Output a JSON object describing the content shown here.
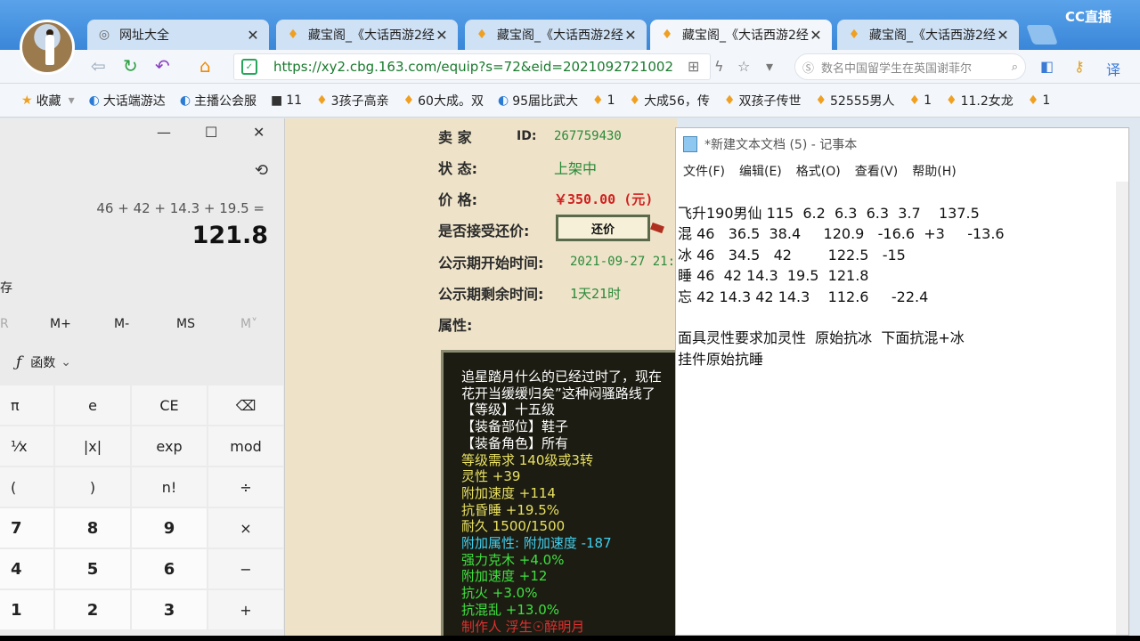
{
  "browser": {
    "tabs": [
      {
        "label": "网址大全",
        "icon": "globe-icon"
      },
      {
        "label": "藏宝阁_《大话西游2经",
        "icon": "shop-icon"
      },
      {
        "label": "藏宝阁_《大话西游2经",
        "icon": "shop-icon"
      },
      {
        "label": "藏宝阁_《大话西游2经",
        "icon": "shop-icon"
      },
      {
        "label": "藏宝阁_《大话西游2经",
        "icon": "shop-icon"
      }
    ],
    "overlay_logo": "CC直播",
    "url": "https://xy2.cbg.163.com/equip?s=72&eid=2021092721002",
    "search_text": "数名中国留学生在英国谢菲尔",
    "bookmarks": [
      "收藏",
      "大话端游达",
      "主播公会服",
      "11",
      "3孩子高亲",
      "60大成。双",
      "95届比武大",
      "1",
      "大成56，传",
      "双孩子传世",
      "52555男人",
      "1",
      "11.2女龙",
      "1"
    ]
  },
  "listing": {
    "seller_label": "卖 家",
    "seller_id_label": "ID:",
    "seller_id": "267759430",
    "status_label": "状 态:",
    "status": "上架中",
    "price_label": "价 格:",
    "price": "￥350.00 (元)",
    "bargain_label": "是否接受还价:",
    "bargain_button": "还价",
    "start_label": "公示期开始时间:",
    "start_time": "2021-09-27 21:",
    "remain_label": "公示期剩余时间:",
    "remain": "1天21时",
    "attr_label": "属性:",
    "desc_lines": [
      {
        "text": "追星踏月什么的已经过时了，现在",
        "color": "#ffffff"
      },
      {
        "text": "花开当缓缓归矣”这种闷骚路线了",
        "color": "#ffffff"
      },
      {
        "text": "【等级】十五级",
        "color": "#ffffff"
      },
      {
        "text": "【装备部位】鞋子",
        "color": "#ffffff"
      },
      {
        "text": "【装备角色】所有",
        "color": "#ffffff"
      },
      {
        "text": "等级需求 140级或3转",
        "color": "#e8e060"
      },
      {
        "text": "灵性 +39",
        "color": "#e8e060"
      },
      {
        "text": "附加速度 +114",
        "color": "#e8e060"
      },
      {
        "text": "抗昏睡 +19.5%",
        "color": "#e8e060"
      },
      {
        "text": "耐久 1500/1500",
        "color": "#e8e060"
      },
      {
        "text": "附加属性: 附加速度 -187",
        "color": "#40d0f0"
      },
      {
        "text": "强力克木 +4.0%",
        "color": "#40e040"
      },
      {
        "text": "附加速度 +12",
        "color": "#40e040"
      },
      {
        "text": "抗火 +3.0%",
        "color": "#40e040"
      },
      {
        "text": "抗混乱 +13.0%",
        "color": "#40e040"
      },
      {
        "text": "制作人 浮生☉醉明月",
        "color": "#e03030"
      }
    ]
  },
  "calculator": {
    "expression": "46 + 42 + 14.3 + 19.5 =",
    "result": "121.8",
    "side_text": "存",
    "memory": [
      "R",
      "M+",
      "M-",
      "MS",
      "M˅"
    ],
    "function_label": "函数",
    "keys": [
      "π",
      "e",
      "CE",
      "⌫",
      "¹⁄x",
      "|x|",
      "exp",
      "mod",
      "(",
      ")",
      "n!",
      "÷",
      "7",
      "8",
      "9",
      "×",
      "4",
      "5",
      "6",
      "−",
      "1",
      "2",
      "3",
      "+"
    ]
  },
  "notepad": {
    "title": "*新建文本文档 (5) - 记事本",
    "menu": [
      "文件(F)",
      "编辑(E)",
      "格式(O)",
      "查看(V)",
      "帮助(H)"
    ],
    "lines": [
      "飞升190男仙 115  6.2  6.3  6.3  3.7    137.5",
      "混 46   36.5  38.4     120.9   -16.6  +3     -13.6",
      "冰 46   34.5   42        122.5   -15",
      "睡 46  42 14.3  19.5  121.8",
      "忘 42 14.3 42 14.3    112.6     -22.4",
      "",
      "面具灵性要求加灵性  原始抗冰  下面抗混+冰",
      "挂件原始抗睡"
    ]
  },
  "colors": {
    "url_green": "#1a7a2e",
    "price_red": "#d02020",
    "value_green": "#2a8a3a"
  }
}
